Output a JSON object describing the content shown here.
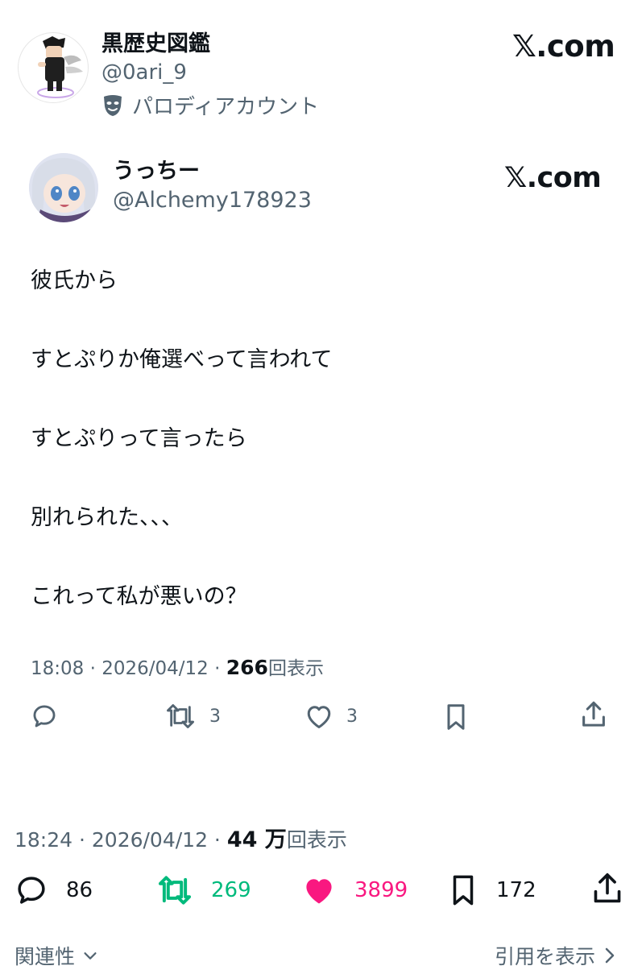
{
  "outer": {
    "display_name": "黒歴史図鑑",
    "handle": "@0ari_9",
    "parody_label": "パロディアカウント",
    "site": "𝕏.com"
  },
  "quoted": {
    "display_name": "うっちー",
    "handle": "@Alchemy178923",
    "site": "𝕏.com",
    "lines": [
      "彼氏から",
      "すとぷりか俺選べって言われて",
      "すとぷりって言ったら",
      "別れられた、、、",
      "これって私が悪いの？"
    ],
    "time": "18:08",
    "date": "2026/04/12",
    "views": "266",
    "views_label": "回表示",
    "retweets": "3",
    "likes": "3"
  },
  "main_meta": {
    "time": "18:24",
    "date": "2026/04/12",
    "views": "44 万",
    "views_label": "回表示"
  },
  "main_stats": {
    "replies": "86",
    "retweets": "269",
    "likes": "3899",
    "bookmarks": "172"
  },
  "footer": {
    "related": "関連性",
    "quotes": "引用を表示"
  },
  "colors": {
    "text": "#0f1419",
    "secondary": "#536471",
    "retweet_green": "#00ba7c",
    "like_pink": "#f91880"
  },
  "icons": [
    "parody-mask-icon",
    "reply-icon",
    "retweet-icon",
    "heart-icon",
    "bookmark-icon",
    "share-icon",
    "chevron-down-icon",
    "chevron-right-icon"
  ]
}
